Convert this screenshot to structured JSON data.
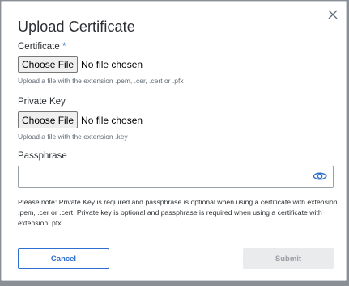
{
  "dialog": {
    "title": "Upload Certificate",
    "close_icon": "close-icon"
  },
  "certificate": {
    "label": "Certificate",
    "required_marker": "*",
    "button_label": "Choose File",
    "status": "No file chosen",
    "hint": "Upload a file with the extension .pem, .cer, .cert or .pfx"
  },
  "private_key": {
    "label": "Private Key",
    "button_label": "Choose File",
    "status": "No file chosen",
    "hint": "Upload a file with the extension .key"
  },
  "passphrase": {
    "label": "Passphrase",
    "value": "",
    "toggle_icon": "eye-icon"
  },
  "note": "Please note: Private Key is required and passphrase is optional when using a certificate with extension .pem, .cer or .cert. Private key is optional and passphrase is required when using a certificate with extension .pfx.",
  "actions": {
    "cancel_label": "Cancel",
    "submit_label": "Submit"
  },
  "colors": {
    "accent": "#2f6fd0",
    "disabled_bg": "#e9ebed",
    "disabled_text": "#9aa0a6"
  }
}
